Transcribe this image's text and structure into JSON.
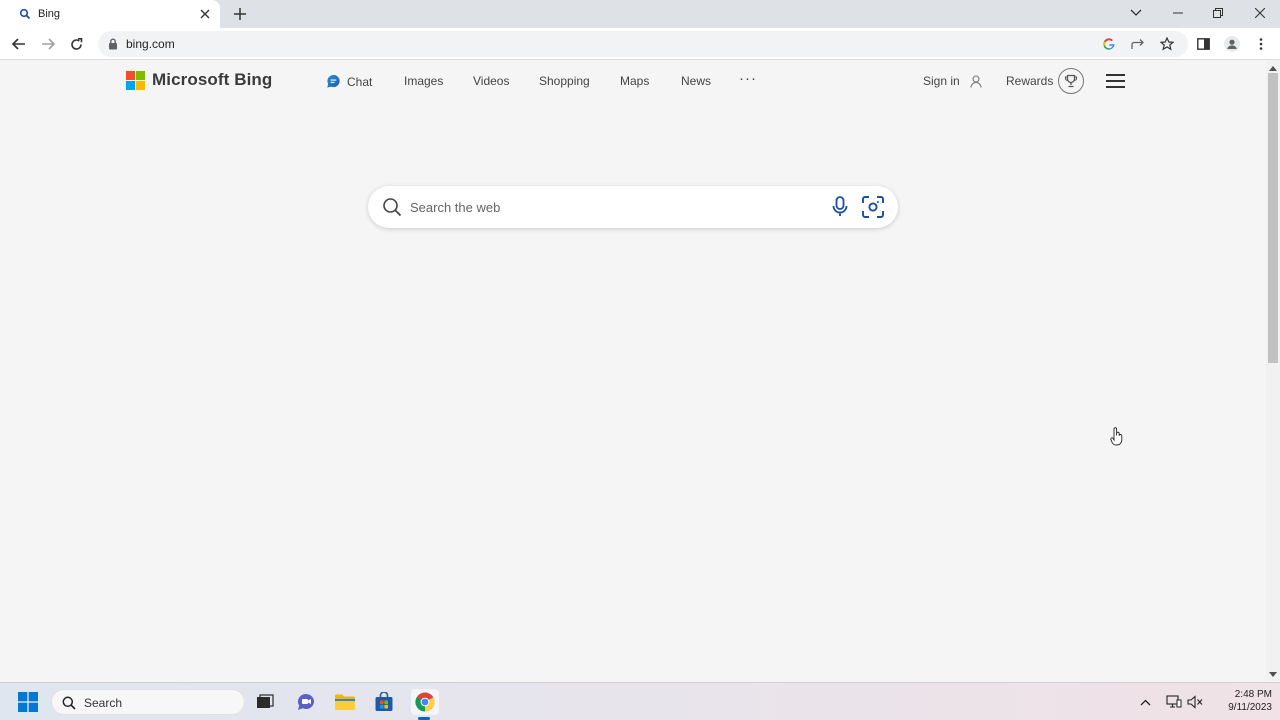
{
  "browser": {
    "tab_title": "Bing",
    "url": "bing.com"
  },
  "header": {
    "logo_text": "Microsoft Bing",
    "nav": [
      "Chat",
      "Images",
      "Videos",
      "Shopping",
      "Maps",
      "News"
    ],
    "more_label": "···",
    "signin_label": "Sign in",
    "rewards_label": "Rewards"
  },
  "search": {
    "placeholder": "Search the web"
  },
  "taskbar": {
    "search_label": "Search",
    "time": "2:48 PM",
    "date": "9/11/2023"
  },
  "colors": {
    "ms_red": "#f25022",
    "ms_green": "#7fba00",
    "ms_blue": "#00a4ef",
    "ms_yellow": "#ffb900",
    "accent_blue": "#1a4fa0"
  }
}
